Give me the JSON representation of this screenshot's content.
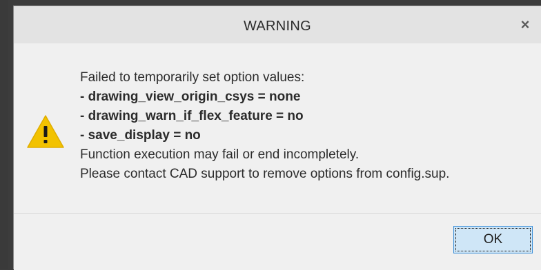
{
  "dialog": {
    "title": "WARNING",
    "close_glyph": "×",
    "icon": "warning-icon",
    "message": {
      "intro": "Failed to temporarily set option values:",
      "options": [
        "- drawing_view_origin_csys = none",
        "- drawing_warn_if_flex_feature = no",
        "- save_display = no"
      ],
      "note_1": "Function execution may fail or end incompletely.",
      "note_2": "Please contact CAD support to remove options from config.sup."
    },
    "ok_label": "OK"
  },
  "colors": {
    "warning_yellow": "#f2c200",
    "ok_button_bg": "#cfe6f7",
    "ok_button_border": "#3c8fd8",
    "titlebar_bg": "#e3e3e3",
    "dialog_bg": "#f0f0f0"
  }
}
